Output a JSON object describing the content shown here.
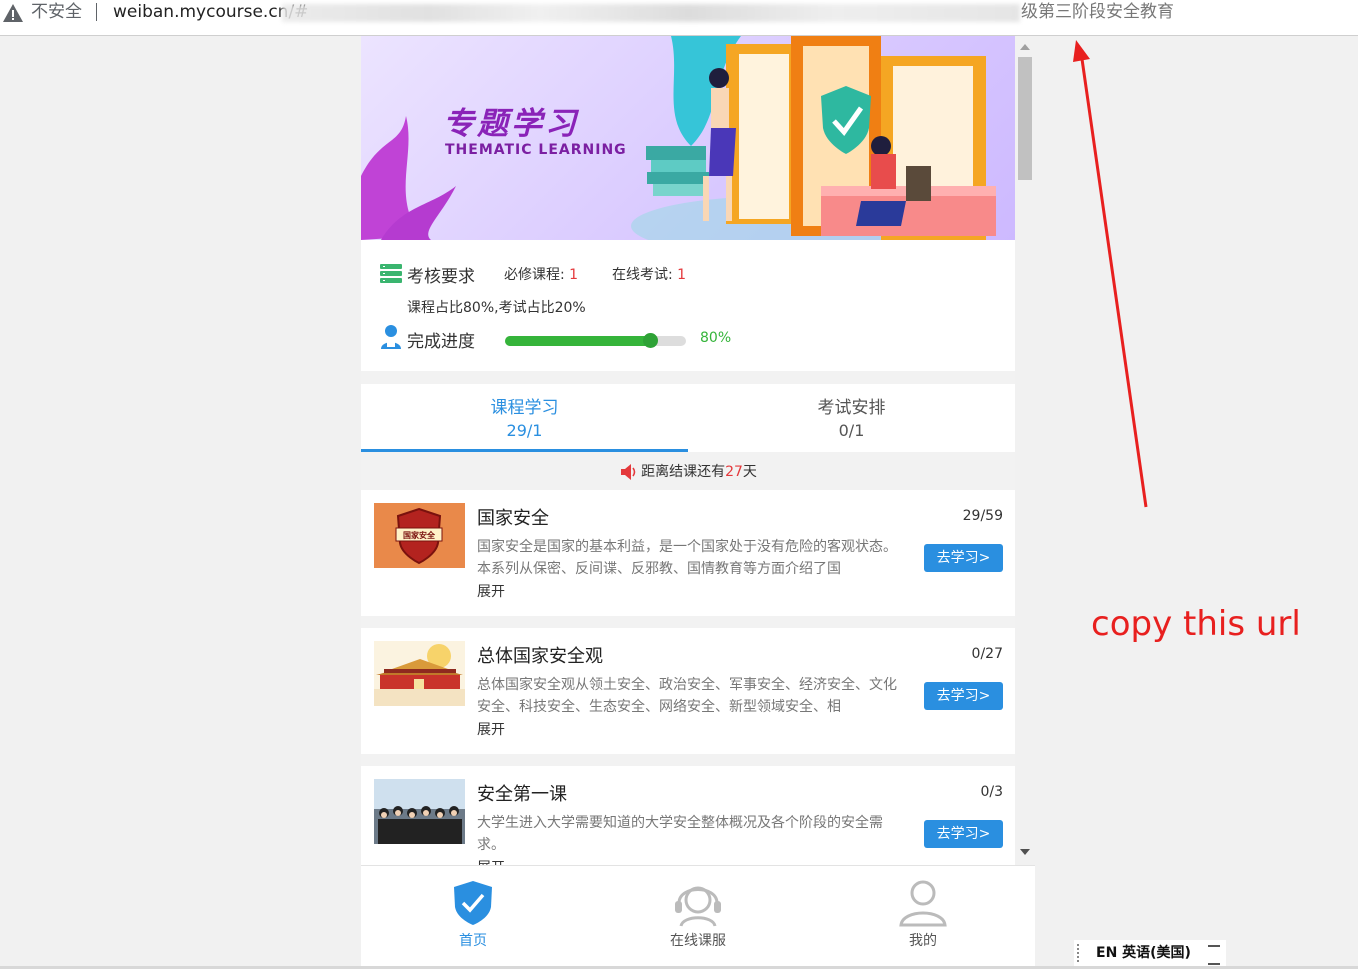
{
  "browser": {
    "security_label": "不安全",
    "url": "weiban.mycourse.cn/#",
    "title_tail": "级第三阶段安全教育"
  },
  "banner": {
    "title_cn": "专题学习",
    "title_en": "THEMATIC LEARNING"
  },
  "requirements": {
    "label": "考核要求",
    "mandatory_label": "必修课程:",
    "mandatory_value": "1",
    "exam_label": "在线考试:",
    "exam_value": "1",
    "ratio": "课程占比80%,考试占比20%",
    "progress_label": "完成进度",
    "progress_text": "80%",
    "progress_fraction": 0.8
  },
  "tabs": [
    {
      "label": "课程学习",
      "count": "29/1"
    },
    {
      "label": "考试安排",
      "count": "0/1"
    }
  ],
  "notice": {
    "prefix": "距离结课还有",
    "days": "27",
    "suffix": "天"
  },
  "courses": [
    {
      "title": "国家安全",
      "count": "29/59",
      "desc": "国家安全是国家的基本利益，是一个国家处于没有危险的客观状态。本系列从保密、反间谍、反邪教、国情教育等方面介绍了国",
      "expand": "展开",
      "button": "去学习>",
      "thumb_text": "国家安全"
    },
    {
      "title": "总体国家安全观",
      "count": "0/27",
      "desc": "总体国家安全观从领土安全、政治安全、军事安全、经济安全、文化安全、科技安全、生态安全、网络安全、新型领域安全、相",
      "expand": "展开",
      "button": "去学习>"
    },
    {
      "title": "安全第一课",
      "count": "0/3",
      "desc": "大学生进入大学需要知道的大学安全整体概况及各个阶段的安全需求。",
      "expand": "展开",
      "button": "去学习>"
    }
  ],
  "bottom_nav": [
    {
      "label": "首页",
      "icon": "shield-check-icon"
    },
    {
      "label": "在线课服",
      "icon": "headset-icon"
    },
    {
      "label": "我的",
      "icon": "user-icon"
    }
  ],
  "annotation": "copy this url",
  "ime": "EN 英语(美国)",
  "colors": {
    "accent": "#2a8fe0",
    "progress": "#35b43a",
    "alert": "#e4393c",
    "annotation": "#e8201f"
  }
}
